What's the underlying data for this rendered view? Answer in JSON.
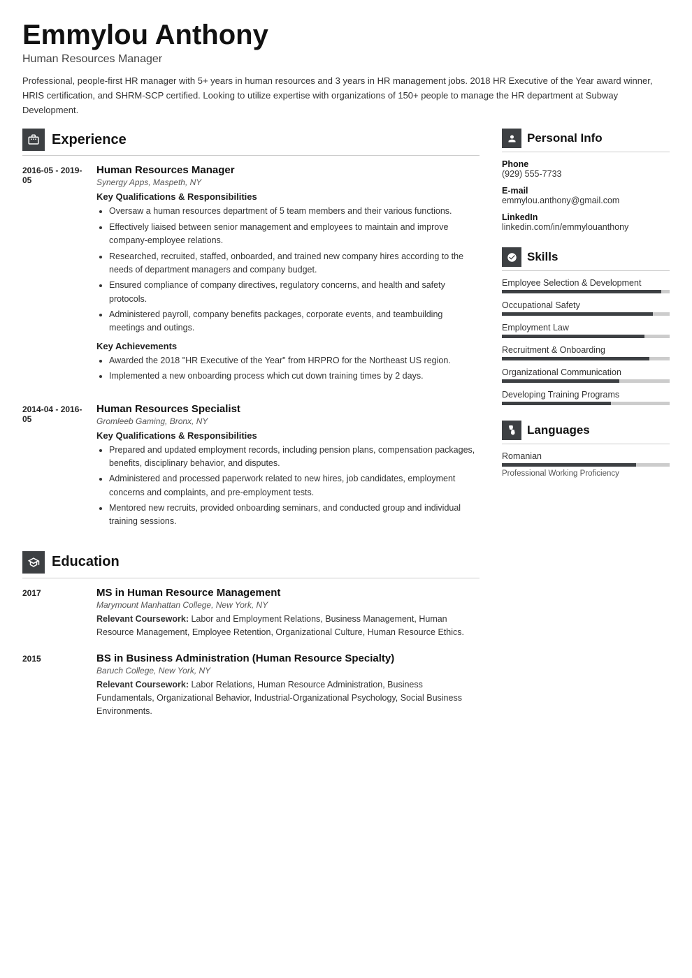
{
  "header": {
    "name": "Emmylou Anthony",
    "subtitle": "Human Resources Manager",
    "summary": "Professional, people-first HR manager with 5+ years in human resources and 3 years in HR management jobs. 2018 HR Executive of the Year award winner, HRIS certification, and SHRM-SCP certified. Looking to utilize expertise with organizations of 150+ people to manage the HR department at Subway Development."
  },
  "sections": {
    "experience_title": "Experience",
    "education_title": "Education",
    "personal_info_title": "Personal Info",
    "skills_title": "Skills",
    "languages_title": "Languages"
  },
  "experience": [
    {
      "date": "2016-05 - 2019-05",
      "title": "Human Resources Manager",
      "company": "Synergy Apps, Maspeth, NY",
      "qualifications_heading": "Key Qualifications & Responsibilities",
      "qualifications": [
        "Oversaw a human resources department of 5 team members and their various functions.",
        "Effectively liaised between senior management and employees to maintain and improve company-employee relations.",
        "Researched, recruited, staffed, onboarded, and trained new company hires according to the needs of department managers and company budget.",
        "Ensured compliance of company directives, regulatory concerns, and health and safety protocols.",
        "Administered payroll, company benefits packages, corporate events, and teambuilding meetings and outings."
      ],
      "achievements_heading": "Key Achievements",
      "achievements": [
        "Awarded the 2018 \"HR Executive of the Year\" from HRPRO for the Northeast US region.",
        "Implemented a new onboarding process which cut down training times by 2 days."
      ]
    },
    {
      "date": "2014-04 - 2016-05",
      "title": "Human Resources Specialist",
      "company": "Gromleeb Gaming, Bronx, NY",
      "qualifications_heading": "Key Qualifications & Responsibilities",
      "qualifications": [
        "Prepared and updated employment records, including pension plans, compensation packages, benefits, disciplinary behavior, and disputes.",
        "Administered and processed paperwork related to new hires, job candidates, employment concerns and complaints, and pre-employment tests.",
        "Mentored new recruits, provided onboarding seminars, and conducted group and individual training sessions."
      ],
      "achievements_heading": null,
      "achievements": []
    }
  ],
  "education": [
    {
      "year": "2017",
      "degree": "MS in Human Resource Management",
      "school": "Marymount Manhattan College, New York, NY",
      "coursework_label": "Relevant Coursework:",
      "coursework": "Labor and Employment Relations, Business Management, Human Resource Management, Employee Retention, Organizational Culture, Human Resource Ethics."
    },
    {
      "year": "2015",
      "degree": "BS in Business Administration (Human Resource Specialty)",
      "school": "Baruch College, New York, NY",
      "coursework_label": "Relevant Coursework:",
      "coursework": "Labor Relations, Human Resource Administration, Business Fundamentals, Organizational Behavior, Industrial-Organizational Psychology, Social Business Environments."
    }
  ],
  "personal_info": {
    "phone_label": "Phone",
    "phone": "(929) 555-7733",
    "email_label": "E-mail",
    "email": "emmylou.anthony@gmail.com",
    "linkedin_label": "LinkedIn",
    "linkedin": "linkedin.com/in/emmylouanthony"
  },
  "skills": [
    {
      "name": "Employee Selection & Development",
      "level": 95
    },
    {
      "name": "Occupational Safety",
      "level": 90
    },
    {
      "name": "Employment Law",
      "level": 85
    },
    {
      "name": "Recruitment & Onboarding",
      "level": 88
    },
    {
      "name": "Organizational Communication",
      "level": 70
    },
    {
      "name": "Developing Training Programs",
      "level": 65
    }
  ],
  "languages": [
    {
      "name": "Romanian",
      "level": "Professional Working Proficiency",
      "bar": 80
    }
  ]
}
